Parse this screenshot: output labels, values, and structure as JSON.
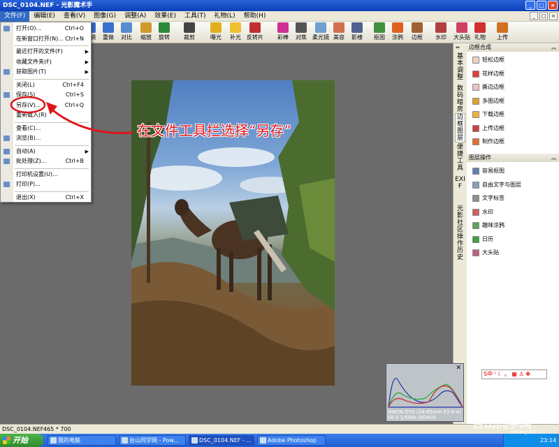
{
  "window": {
    "title": "DSC_0104.NEF - 光影魔术手"
  },
  "menubar": [
    "文件(F)",
    "编辑(E)",
    "查看(V)",
    "图像(G)",
    "调整(A)",
    "效果(E)",
    "工具(T)",
    "礼物(L)",
    "帮助(H)"
  ],
  "toolbar": [
    {
      "label": "",
      "icon": "open-icon",
      "color": "#c08a2a"
    },
    {
      "label": "另存",
      "icon": "save-as-icon",
      "color": "#3a6fd0"
    },
    {
      "label": "撤销",
      "icon": "undo-icon",
      "color": "#3a6fd0"
    },
    {
      "label": "重做",
      "icon": "redo-icon",
      "color": "#3a6fd0"
    },
    {
      "label": "对比",
      "icon": "compare-icon",
      "color": "#5a8ad0"
    },
    {
      "label": "缩放",
      "icon": "zoom-icon",
      "color": "#d09a2a"
    },
    {
      "label": "旋转",
      "icon": "rotate-icon",
      "color": "#2a8a3a"
    },
    {
      "label": "裁剪",
      "icon": "crop-icon",
      "color": "#444444"
    },
    {
      "label": "曝光",
      "icon": "exposure-icon",
      "color": "#e0b020"
    },
    {
      "label": "补光",
      "icon": "fill-light-icon",
      "color": "#f0c030"
    },
    {
      "label": "反转片",
      "icon": "slide-film-icon",
      "color": "#c03030"
    },
    {
      "label": "彩棒",
      "icon": "color-stick-icon",
      "color": "#d03090"
    },
    {
      "label": "对焦",
      "icon": "focus-icon",
      "color": "#555555"
    },
    {
      "label": "柔光镜",
      "icon": "soft-filter-icon",
      "color": "#70a0d0"
    },
    {
      "label": "美容",
      "icon": "beauty-icon",
      "color": "#d07050"
    },
    {
      "label": "影楼",
      "icon": "studio-icon",
      "color": "#506090"
    },
    {
      "label": "抠图",
      "icon": "cutout-icon",
      "color": "#409040"
    },
    {
      "label": "涂鸦",
      "icon": "doodle-icon",
      "color": "#e06020"
    },
    {
      "label": "边框",
      "icon": "frame-icon",
      "color": "#a06030"
    },
    {
      "label": "水印",
      "icon": "watermark-icon",
      "color": "#b04040"
    },
    {
      "label": "大头贴",
      "icon": "photo-sticker-icon",
      "color": "#d04060"
    },
    {
      "label": "礼物",
      "icon": "gift-icon",
      "color": "#d03030"
    },
    {
      "label": "上传",
      "icon": "upload-icon",
      "color": "#d07020"
    }
  ],
  "file_menu": [
    {
      "label": "打开(O)...",
      "shortcut": "Ctrl+O",
      "icon": "open-icon",
      "sep_before": false
    },
    {
      "label": "在新窗口打开(N)...",
      "shortcut": "Ctrl+N",
      "icon": "",
      "sep_before": false
    },
    {
      "label": "最近打开的文件(F)",
      "shortcut": "",
      "icon": "",
      "submenu": true,
      "sep_before": true
    },
    {
      "label": "收藏文件夹(F)",
      "shortcut": "",
      "icon": "",
      "submenu": true,
      "sep_before": false
    },
    {
      "label": "获取图片(T)",
      "shortcut": "",
      "icon": "scanner-icon",
      "submenu": true,
      "sep_before": false
    },
    {
      "label": "关闭(L)",
      "shortcut": "Ctrl+F4",
      "icon": "",
      "sep_before": true
    },
    {
      "label": "保存(S)",
      "shortcut": "Ctrl+S",
      "icon": "save-icon",
      "sep_before": false
    },
    {
      "label": "另存(V)...",
      "shortcut": "Ctrl+Q",
      "icon": "",
      "sep_before": false
    },
    {
      "label": "重新载入(R)",
      "shortcut": "",
      "icon": "",
      "sep_before": false
    },
    {
      "label": "查看(C)...",
      "shortcut": "",
      "icon": "",
      "sep_before": true
    },
    {
      "label": "浏览(B)...",
      "shortcut": "",
      "icon": "browse-icon",
      "sep_before": false
    },
    {
      "label": "自动(A)",
      "shortcut": "",
      "icon": "auto-icon",
      "submenu": true,
      "sep_before": true
    },
    {
      "label": "批处理(Z)...",
      "shortcut": "Ctrl+B",
      "icon": "batch-icon",
      "sep_before": false
    },
    {
      "label": "打印机设置(U)...",
      "shortcut": "",
      "icon": "",
      "sep_before": true
    },
    {
      "label": "打印(P)...",
      "shortcut": "",
      "icon": "print-icon",
      "sep_before": false
    },
    {
      "label": "退出(X)",
      "shortcut": "Ctrl+X",
      "icon": "",
      "sep_before": true
    }
  ],
  "annotation": "在文件工具拦选择“另存”",
  "vertical_tabs": [
    "基本调整",
    "数码暗房",
    "边框图层",
    "便捷工具",
    "EXIF",
    "光影社区",
    "操作历史"
  ],
  "right_panel": {
    "section1_title": "边框合成",
    "section1_items": [
      "轻松边框",
      "花样边框",
      "撕边边框",
      "多图边框",
      "下载边框",
      "上传边框",
      "制作边框"
    ],
    "section2_title": "图层操作",
    "section2_items": [
      "容易抠图",
      "自由文字与图层",
      "文字标签",
      "水印",
      "趣味涂鸦",
      "日历",
      "大头贴"
    ]
  },
  "histogram": {
    "caption_line1": "NIKON D70 (24-85mm F2.8-4)",
    "caption_line2": "F8.0 1/500s ISO400"
  },
  "ime": "S中 ⁾ ☾ 。 ▦ ♙ ✤",
  "statusbar": {
    "filename": "DSC_0104.NEF",
    "size": "465 * 700"
  },
  "taskbar": {
    "start": "开始",
    "tasks": [
      "我的电脑",
      "台山同学网 - Pow...",
      "DSC_0104.NEF - ...",
      "Adobe Photoshop"
    ],
    "time": "23:14"
  },
  "watermark": {
    "text": "台山同学网",
    "url": "www.jsbe.cn"
  }
}
